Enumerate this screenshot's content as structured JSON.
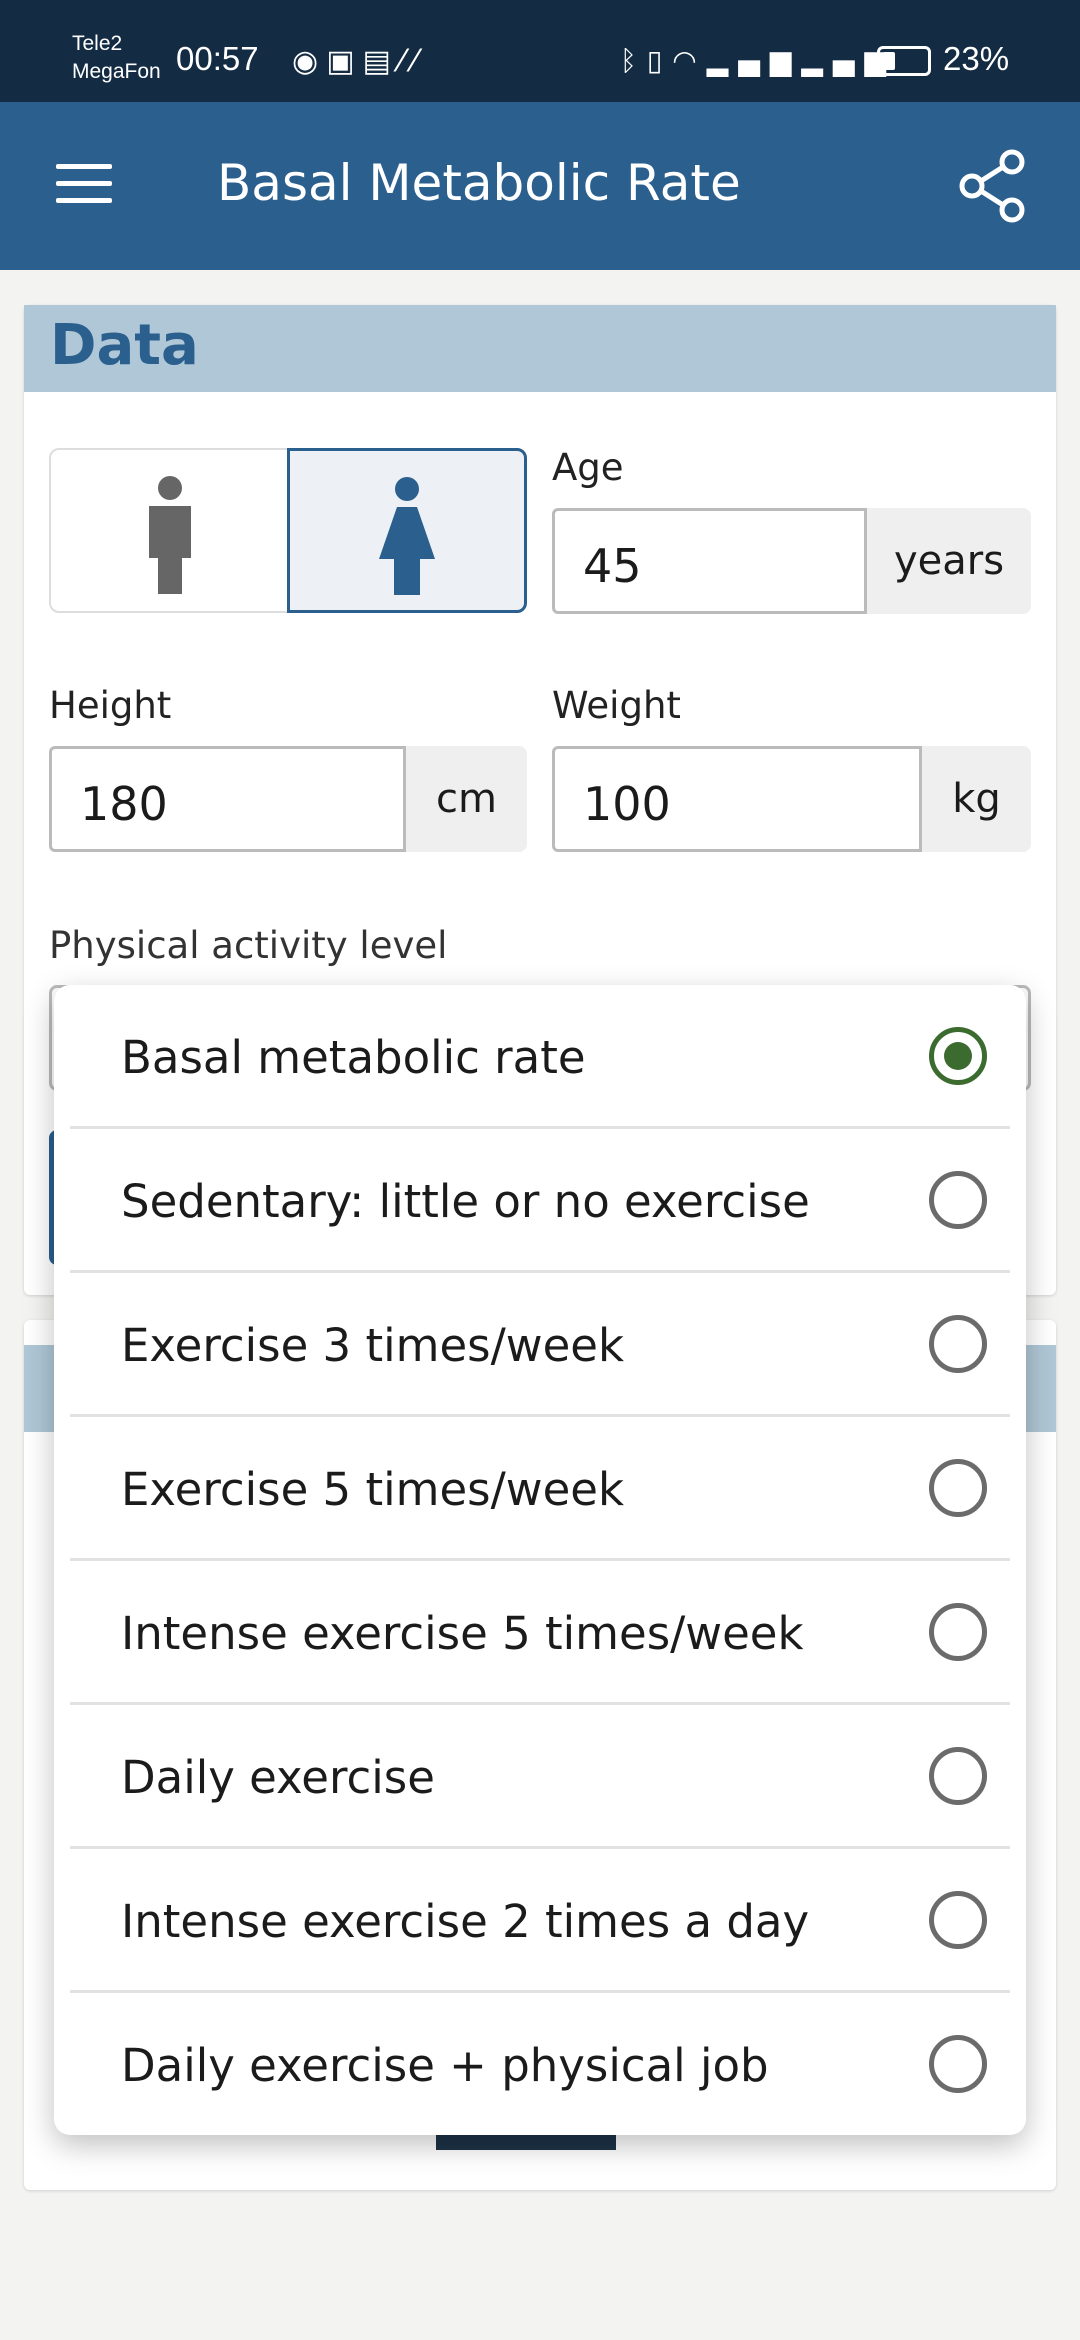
{
  "status_bar": {
    "carrier1": "Tele2",
    "carrier2": "MegaFon",
    "time": "00:57",
    "battery": "23%",
    "icons": [
      "eye-icon",
      "nfc-icon",
      "mail-icon",
      "app-icon",
      "bluetooth-icon",
      "vibrate-icon",
      "wifi-icon",
      "signal-icon",
      "signal-icon",
      "battery-icon"
    ]
  },
  "app_bar": {
    "title": "Basal Metabolic Rate",
    "menu_icon": "menu-icon",
    "share_icon": "share-icon"
  },
  "data_card": {
    "title": "Data",
    "gender": {
      "options": [
        "male",
        "female"
      ],
      "selected": "female"
    },
    "age": {
      "label": "Age",
      "value": "45",
      "unit": "years"
    },
    "height": {
      "label": "Height",
      "value": "180",
      "unit": "cm"
    },
    "weight": {
      "label": "Weight",
      "value": "100",
      "unit": "kg"
    },
    "activity_label": "Physical activity level"
  },
  "dropdown": {
    "selected_index": 0,
    "options": [
      {
        "label": "Basal metabolic rate"
      },
      {
        "label": "Sedentary: little or no exercise"
      },
      {
        "label": "Exercise 3 times/week"
      },
      {
        "label": "Exercise 5 times/week"
      },
      {
        "label": "Intense exercise 5 times/week"
      },
      {
        "label": "Daily exercise"
      },
      {
        "label": "Intense exercise 2 times a day"
      },
      {
        "label": "Daily exercise + physical job"
      }
    ]
  },
  "colors": {
    "primary": "#2a5f8e",
    "status_bar": "#132b43",
    "header_band": "#afc7d6",
    "radio_selected": "#3b6b2e"
  }
}
